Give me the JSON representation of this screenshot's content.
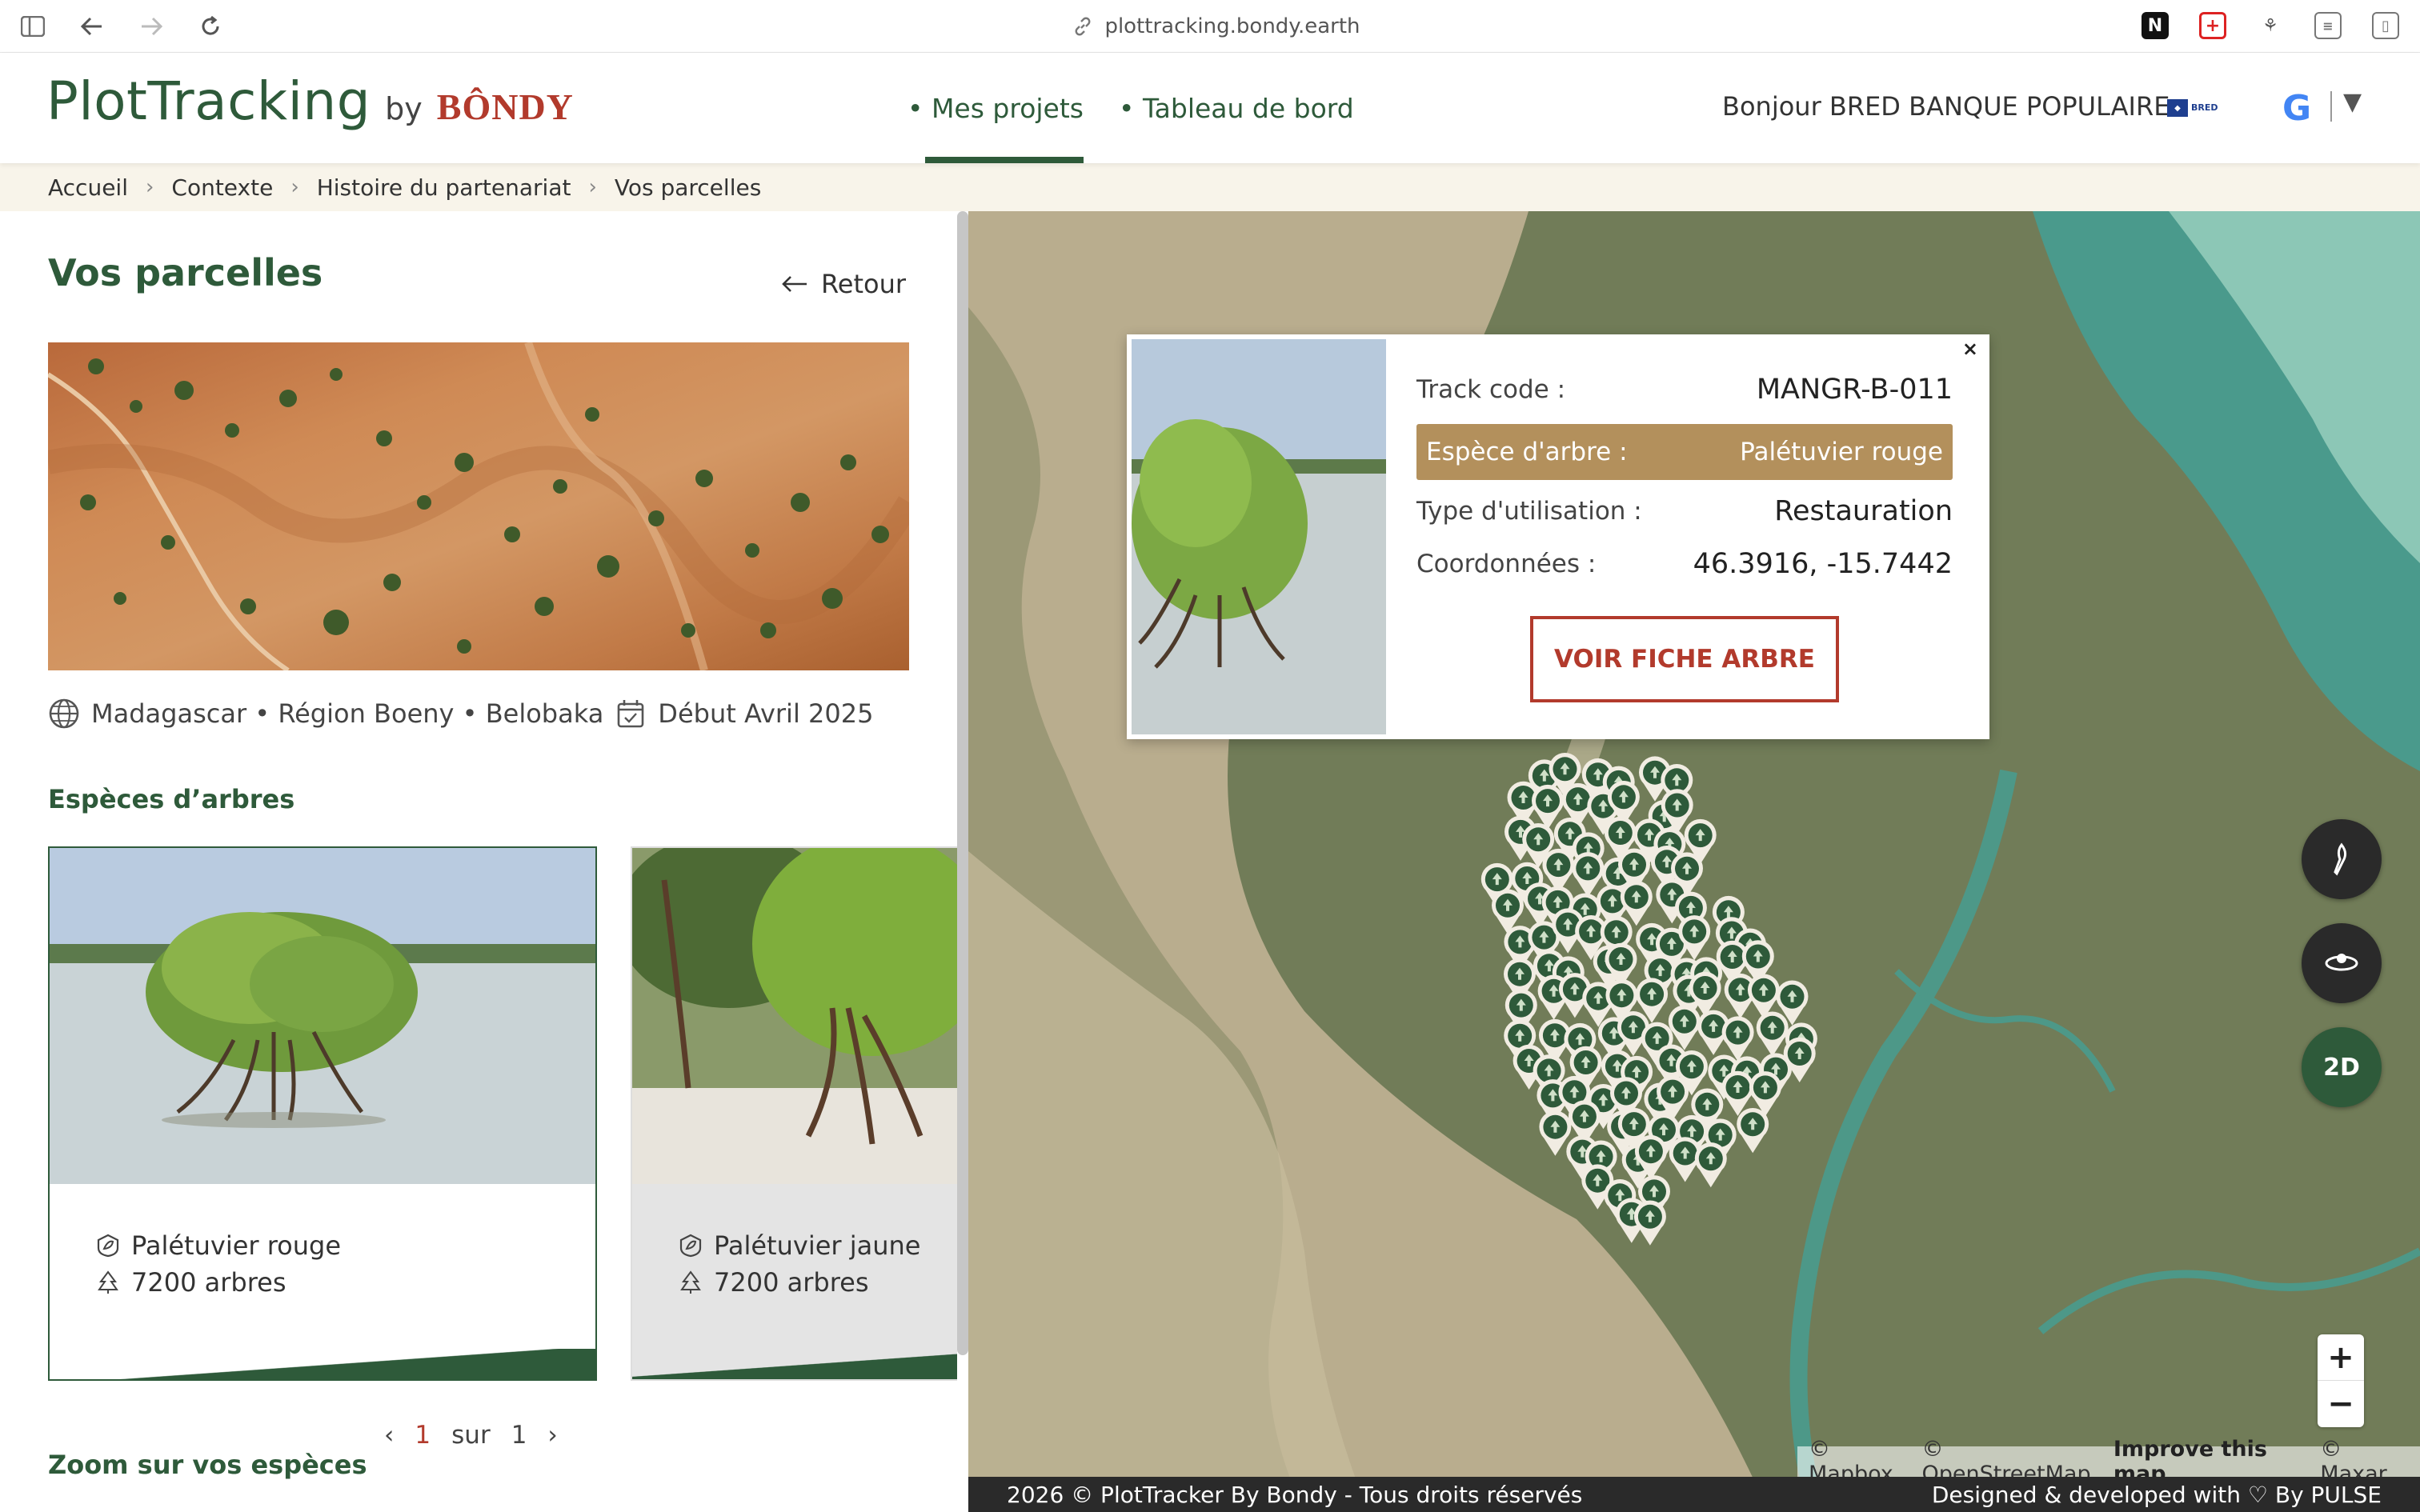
{
  "browser": {
    "url": "plottracking.bondy.earth"
  },
  "header": {
    "logo_plot": "PlotTracking",
    "logo_by": "by",
    "logo_bondy": "BÔNDY",
    "nav": [
      {
        "label": "• Mes projets",
        "active": true
      },
      {
        "label": "• Tableau de bord",
        "active": false
      }
    ],
    "greeting": "Bonjour BRED BANQUE POPULAIRE",
    "partner_logo_text": "BRED"
  },
  "breadcrumb": [
    "Accueil",
    "Contexte",
    "Histoire du partenariat",
    "Vos parcelles"
  ],
  "page": {
    "title": "Vos parcelles",
    "back_label": "Retour",
    "location": "Madagascar • Région Boeny • Belobaka",
    "start_date": "Début Avril 2025",
    "species_heading": "Espèces d’arbres",
    "zoom_heading": "Zoom sur vos espèces"
  },
  "species_cards": [
    {
      "name": "Palétuvier rouge",
      "count": "7200 arbres"
    },
    {
      "name": "Palétuvier jaune",
      "count": "7200 arbres"
    }
  ],
  "pager": {
    "current": "1",
    "of": "sur",
    "total": "1"
  },
  "popup": {
    "track_label": "Track code :",
    "track_value": "MANGR-B-011",
    "species_label": "Espèce d'arbre :",
    "species_value": "Palétuvier rouge",
    "usage_label": "Type d'utilisation :",
    "usage_value": "Restauration",
    "coords_label": "Coordonnées :",
    "coords_value": "46.3916, -15.7442",
    "cta": "VOIR FICHE ARBRE",
    "close": "×"
  },
  "map": {
    "control_2d": "2D",
    "zoom_in": "+",
    "zoom_out": "−",
    "attribution": [
      "© Mapbox",
      "© OpenStreetMap",
      "Improve this map",
      "© Maxar"
    ]
  },
  "footer": {
    "left": "2026 © PlotTracker By Bondy - Tous droits réservés",
    "right": "Designed & developed with ♡ By PULSE"
  },
  "colors": {
    "brand_green": "#2e5a3a",
    "brand_red": "#b23a2c",
    "highlight_tan": "#b3905c"
  }
}
